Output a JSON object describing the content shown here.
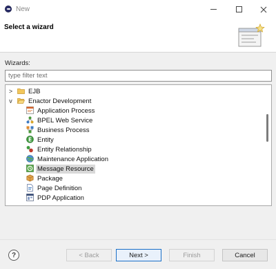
{
  "window": {
    "title": "New",
    "minimize_icon": "minimize-icon",
    "maximize_icon": "maximize-icon",
    "close_icon": "close-icon"
  },
  "banner": {
    "title": "Select a wizard",
    "image_icon": "wizard-banner-icon"
  },
  "filter": {
    "label": "Wizards:",
    "placeholder": "type filter text",
    "value": ""
  },
  "tree": {
    "items": [
      {
        "label": "EJB",
        "icon": "folder-icon",
        "twisty": ">",
        "expanded": false
      },
      {
        "label": "Enactor Development",
        "icon": "folder-open-icon",
        "twisty": "v",
        "expanded": true
      },
      {
        "label": "Application Process",
        "icon": "application-process-icon"
      },
      {
        "label": "BPEL Web Service",
        "icon": "bpel-web-service-icon"
      },
      {
        "label": "Business Process",
        "icon": "business-process-icon"
      },
      {
        "label": "Entity",
        "icon": "entity-icon"
      },
      {
        "label": "Entity Relationship",
        "icon": "entity-relationship-icon"
      },
      {
        "label": "Maintenance Application",
        "icon": "maintenance-application-icon"
      },
      {
        "label": "Message Resource",
        "icon": "message-resource-icon",
        "selected": true
      },
      {
        "label": "Package",
        "icon": "package-icon"
      },
      {
        "label": "Page Definition",
        "icon": "page-definition-icon"
      },
      {
        "label": "PDP Application",
        "icon": "pdp-application-icon"
      }
    ]
  },
  "footer": {
    "help_label": "?",
    "back_label": "< Back",
    "next_label": "Next >",
    "finish_label": "Finish",
    "cancel_label": "Cancel"
  },
  "colors": {
    "primary_button_border": "#1a6fc7",
    "selection_background": "#d9d9d9",
    "folder": "#e8b04b"
  }
}
